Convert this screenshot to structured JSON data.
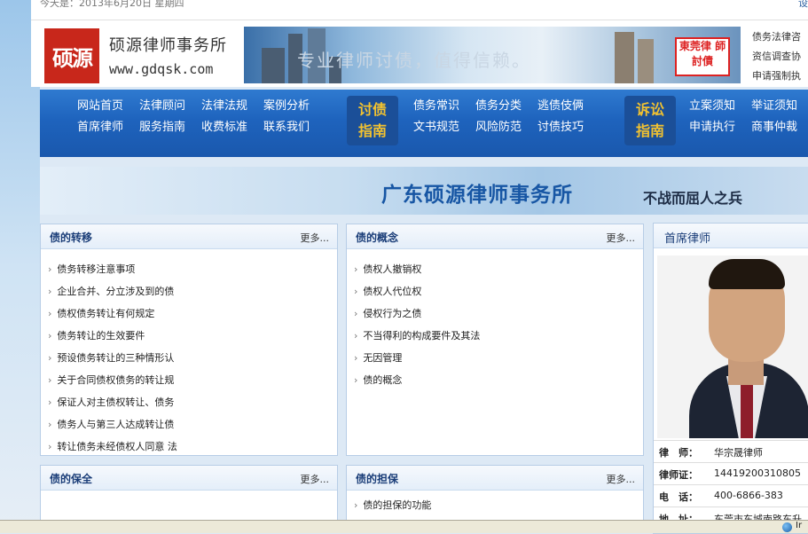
{
  "topbar": {
    "date": "今天是：2013年6月20日 星期四",
    "settings": "设"
  },
  "header": {
    "logo_text": "硕源",
    "brand_name": "硕源律师事务所",
    "url": "www.gdqsk.com",
    "banner_slogan": "专业律师讨债，值得信赖。",
    "stamp_text": "東莞律 師討債",
    "side_links": [
      "债务法律咨",
      "资信调查协",
      "申请强制执"
    ]
  },
  "nav": {
    "group1": [
      "网站首页",
      "法律顾问",
      "法律法规",
      "案例分析",
      "首席律师",
      "服务指南",
      "收费标准",
      "联系我们"
    ],
    "badge1": [
      "讨债",
      "指南"
    ],
    "group2": [
      "债务常识",
      "债务分类",
      "逃债伎俩",
      "文书规范",
      "风险防范",
      "讨债技巧"
    ],
    "badge2": [
      "诉讼",
      "指南"
    ],
    "group3": [
      "立案须知",
      "举证须知",
      "申请执行",
      "商事仲裁"
    ]
  },
  "subbanner": {
    "title": "广东硕源律师事务所",
    "tagline": "不战而屈人之兵"
  },
  "panels": {
    "transfer": {
      "title": "债的转移",
      "more": "更多...",
      "items": [
        "债务转移注意事项",
        "企业合并、分立涉及到的债",
        "债权债务转让有何规定",
        "债务转让的生效要件",
        "预设债务转让的三种情形认",
        "关于合同债权债务的转让规",
        "保证人对主债权转让、债务",
        "债务人与第三人达成转让债",
        "转让债务未经债权人同意 法"
      ]
    },
    "concept": {
      "title": "债的概念",
      "more": "更多...",
      "items": [
        "债权人撤销权",
        "债权人代位权",
        "侵权行为之债",
        "不当得利的构成要件及其法",
        "无因管理",
        "债的概念"
      ]
    },
    "preserve": {
      "title": "债的保全",
      "more": "更多...",
      "items": []
    },
    "guarantee": {
      "title": "债的担保",
      "more": "更多...",
      "items": [
        "债的担保的功能"
      ]
    }
  },
  "lawyer": {
    "title": "首席律师",
    "rows": [
      {
        "k": "律　师：",
        "v": "华宗晟律师"
      },
      {
        "k": "律师证：",
        "v": "14419200310805"
      },
      {
        "k": "电　话：",
        "v": "400-6866-383"
      },
      {
        "k": "地　址：",
        "v": "东莞市东城南路东升"
      }
    ]
  },
  "statusbar": {
    "text": "Ir"
  }
}
